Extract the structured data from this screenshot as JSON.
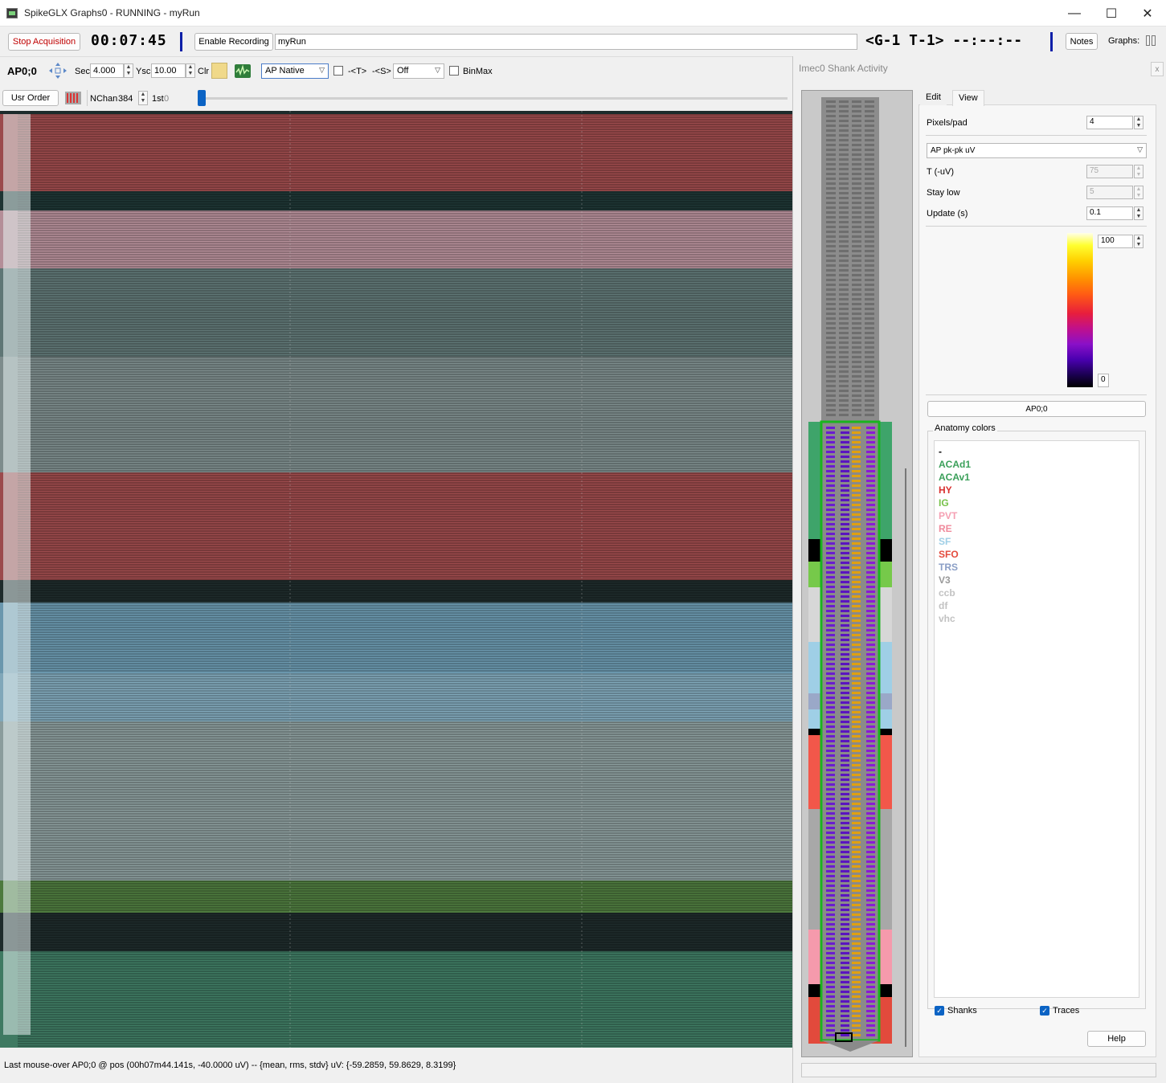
{
  "window": {
    "title": "SpikeGLX Graphs0 - RUNNING - myRun",
    "minimize": "—",
    "maximize": "☐",
    "close": "✕"
  },
  "toolbar": {
    "stop_label": "Stop Acquisition",
    "timer": "00:07:45",
    "record_label": "Enable Recording",
    "run_name": "myRun",
    "gt_label": "<G-1 T-1> --:--:--",
    "notes_label": "Notes",
    "graphs_label": "Graphs:"
  },
  "graph_controls": {
    "stream_label": "AP0;0",
    "sec_label": "Sec",
    "sec_value": "4.000",
    "ysc_label": "Ysc",
    "ysc_value": "10.00",
    "clr_label": "Clr",
    "filter_value": "AP Native",
    "t_label": "-<T>",
    "s_label": "-<S>",
    "s_value": "Off",
    "binmax_label": "BinMax",
    "usr_order_label": "Usr Order",
    "nchan_label": "NChan",
    "nchan_value": "384",
    "first_label": "1st",
    "first_value": "0"
  },
  "graph": {
    "bands": [
      {
        "color": "#9b4a4c"
      },
      {
        "color": "#1e3534"
      },
      {
        "color": "#b48e98"
      },
      {
        "color": "#5f7675"
      },
      {
        "color": "#7d8c8c"
      },
      {
        "color": "#9b4a4c"
      },
      {
        "color": "#1e2b2b"
      },
      {
        "color": "#6a97ad"
      },
      {
        "color": "#80a7b9"
      },
      {
        "color": "#8a9c9c"
      },
      {
        "color": "#4d7a3e"
      },
      {
        "color": "#1e2b2b"
      },
      {
        "color": "#3f7a62"
      }
    ]
  },
  "status": {
    "text": "Last mouse-over AP0;0 @ pos (00h07m44.141s, -40.0000 uV) -- {mean, rms, stdv} uV: {-59.2859, 59.8629, 8.3199}"
  },
  "shank_panel": {
    "title": "Imec0 Shank Activity",
    "close_label": "x",
    "tabs": [
      {
        "label": "Edit"
      },
      {
        "label": "View"
      }
    ],
    "pixels_label": "Pixels/pad",
    "pixels_value": "4",
    "mode_value": "AP pk-pk uV",
    "t_label": "T (-uV)",
    "t_value": "75",
    "staylow_label": "Stay low",
    "staylow_value": "5",
    "update_label": "Update (s)",
    "update_value": "0.1",
    "colorbar_max": "100",
    "colorbar_min": "0",
    "stream_button": "AP0;0",
    "anatomy_title": "Anatomy colors",
    "anatomy": [
      {
        "name": "-",
        "color": "#000000"
      },
      {
        "name": "ACAd1",
        "color": "#3ba05a"
      },
      {
        "name": "ACAv1",
        "color": "#3ba05a"
      },
      {
        "name": "HY",
        "color": "#d9302f"
      },
      {
        "name": "IG",
        "color": "#77c24a"
      },
      {
        "name": "PVT",
        "color": "#f5a0b3"
      },
      {
        "name": "RE",
        "color": "#f08a9c"
      },
      {
        "name": "SF",
        "color": "#9fcfe6"
      },
      {
        "name": "SFO",
        "color": "#e34b3d"
      },
      {
        "name": "TRS",
        "color": "#8a9ec6"
      },
      {
        "name": "V3",
        "color": "#9a9a9a"
      },
      {
        "name": "ccb",
        "color": "#c2c2c2"
      },
      {
        "name": "df",
        "color": "#c2c2c2"
      },
      {
        "name": "vhc",
        "color": "#c2c2c2"
      }
    ],
    "shanks_label": "Shanks",
    "shanks_checked": true,
    "traces_label": "Traces",
    "traces_checked": true,
    "help_label": "Help",
    "regions": [
      {
        "color": "#3ea46a"
      },
      {
        "color": "#000000"
      },
      {
        "color": "#76c94a"
      },
      {
        "color": "#d7d7d7"
      },
      {
        "color": "#9fcfe6"
      },
      {
        "color": "#9aa8c8"
      },
      {
        "color": "#9fcfe6"
      },
      {
        "color": "#000000"
      },
      {
        "color": "#f2574a"
      },
      {
        "color": "#a8a8a8"
      },
      {
        "color": "#f59aac"
      },
      {
        "color": "#000000"
      },
      {
        "color": "#e24a3c"
      }
    ]
  }
}
